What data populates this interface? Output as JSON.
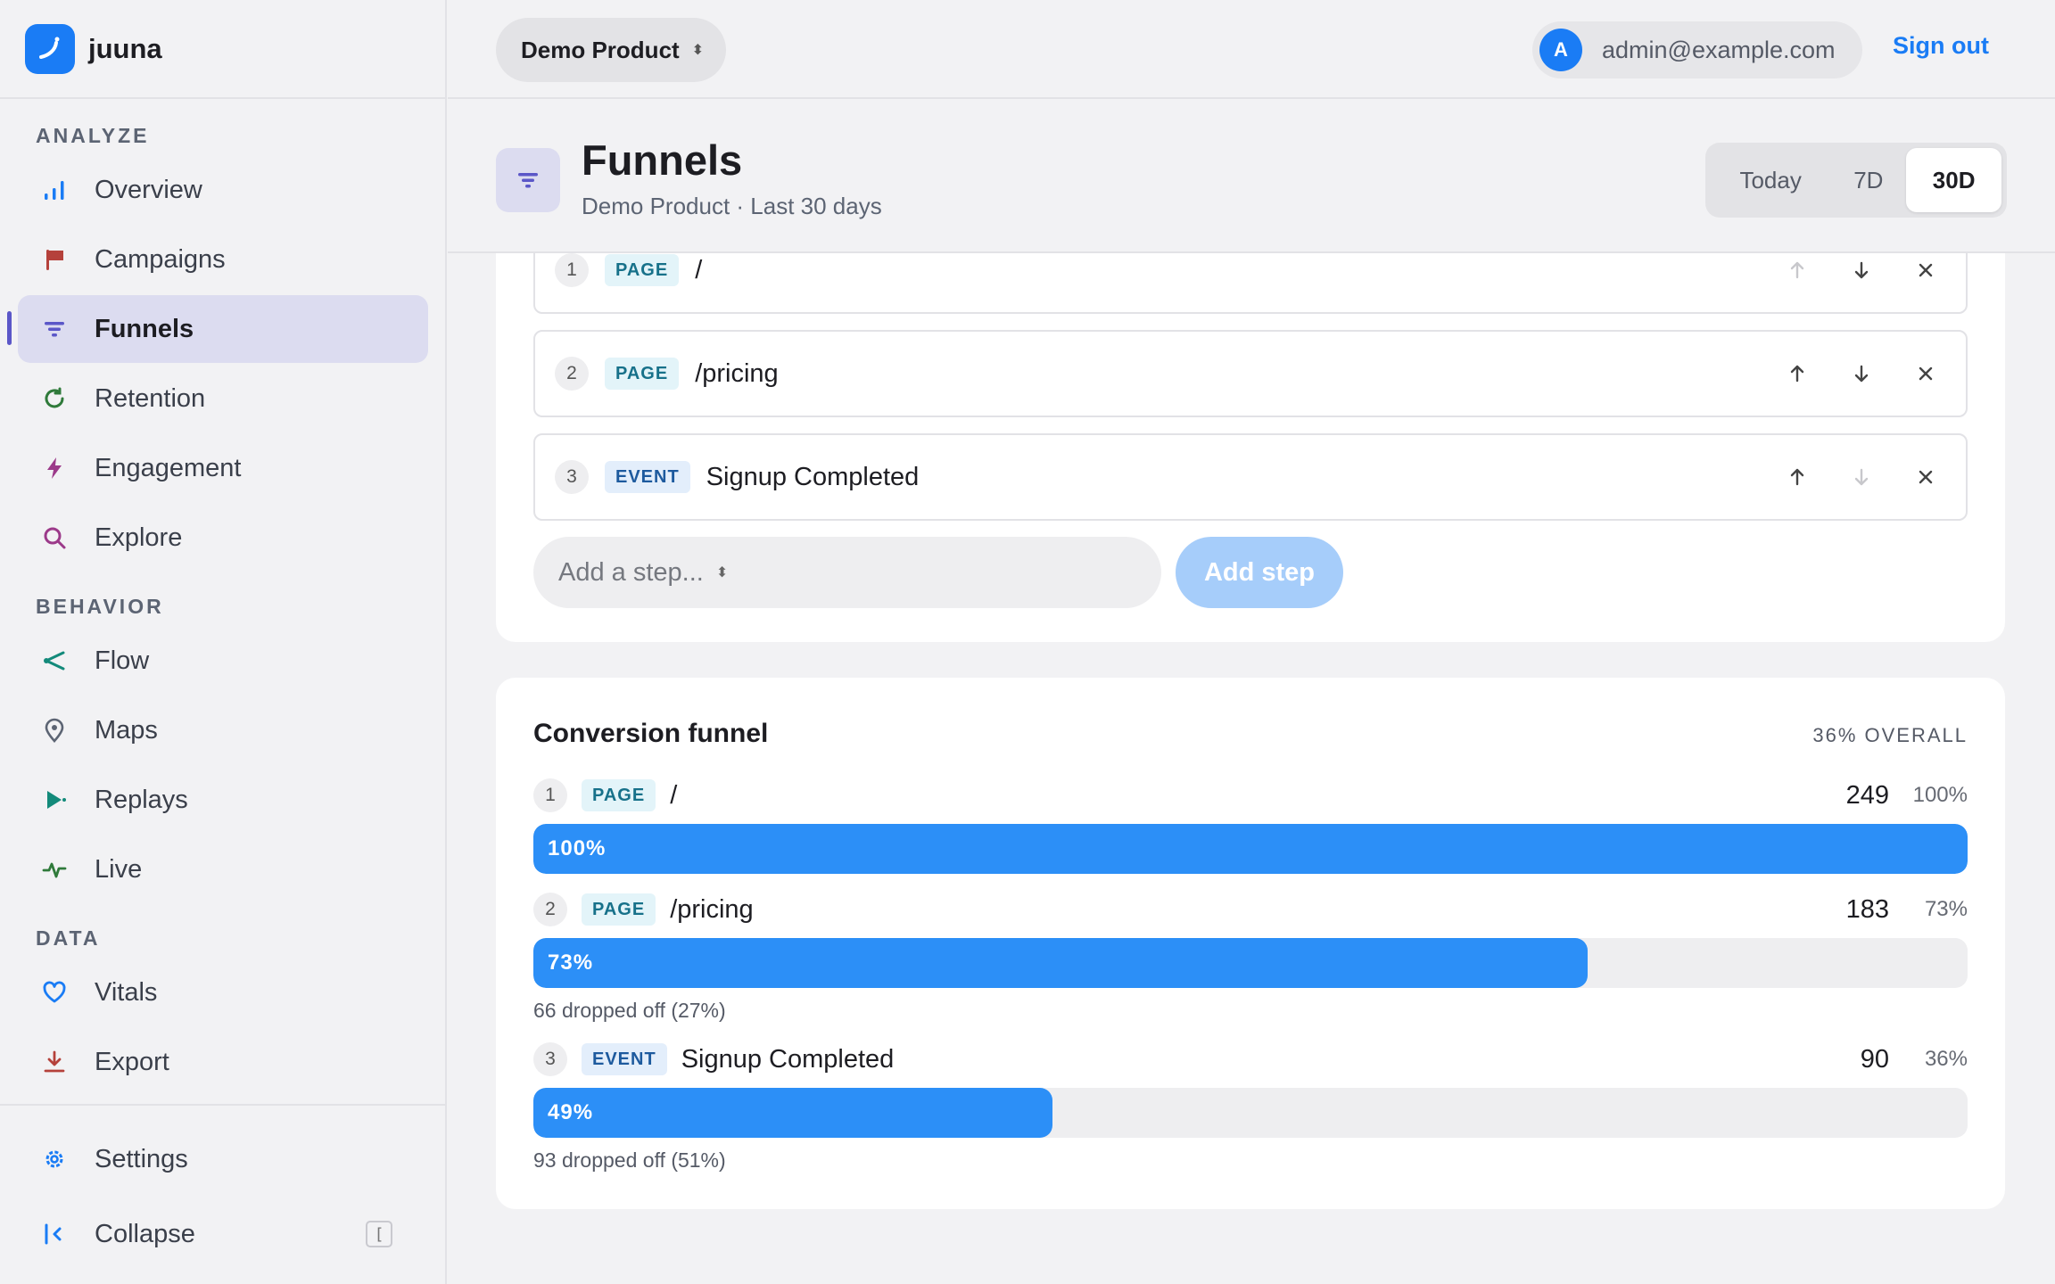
{
  "brand": {
    "name": "juuna"
  },
  "sidebar": {
    "sections": [
      {
        "label": "ANALYZE"
      },
      {
        "label": "BEHAVIOR"
      },
      {
        "label": "DATA"
      }
    ],
    "items": [
      {
        "label": "Overview",
        "icon": "bar-chart-icon",
        "color": "#1a7cf5"
      },
      {
        "label": "Campaigns",
        "icon": "flag-icon",
        "color": "#b5413b"
      },
      {
        "label": "Funnels",
        "icon": "funnel-icon",
        "color": "#5b57c8",
        "active": true
      },
      {
        "label": "Retention",
        "icon": "refresh-icon",
        "color": "#2f7a3a"
      },
      {
        "label": "Engagement",
        "icon": "bolt-icon",
        "color": "#9c3a8a"
      },
      {
        "label": "Explore",
        "icon": "search-icon",
        "color": "#9c3a8a"
      },
      {
        "label": "Flow",
        "icon": "share-icon",
        "color": "#138a7a"
      },
      {
        "label": "Maps",
        "icon": "map-pin-icon",
        "color": "#5c6473"
      },
      {
        "label": "Replays",
        "icon": "play-icon",
        "color": "#138a7a"
      },
      {
        "label": "Live",
        "icon": "pulse-icon",
        "color": "#2f7a3a"
      },
      {
        "label": "Vitals",
        "icon": "heart-icon",
        "color": "#1a7cf5"
      },
      {
        "label": "Export",
        "icon": "download-icon",
        "color": "#b5413b"
      }
    ],
    "settings_label": "Settings",
    "collapse_label": "Collapse",
    "collapse_shortcut": "["
  },
  "topbar": {
    "product": "Demo Product",
    "user_initial": "A",
    "user_email": "admin@example.com",
    "signout_label": "Sign out"
  },
  "header": {
    "title": "Funnels",
    "subtitle": "Demo Product · Last 30 days",
    "ranges": [
      "Today",
      "7D",
      "30D"
    ],
    "selected_range": "30D"
  },
  "steps_editor": {
    "steps": [
      {
        "num": "1",
        "type": "PAGE",
        "label": "/"
      },
      {
        "num": "2",
        "type": "PAGE",
        "label": "/pricing"
      },
      {
        "num": "3",
        "type": "EVENT",
        "label": "Signup Completed"
      }
    ],
    "add_placeholder": "Add a step...",
    "add_button": "Add step"
  },
  "funnel": {
    "title": "Conversion funnel",
    "overall": "36% OVERALL",
    "steps": [
      {
        "num": "1",
        "type": "PAGE",
        "label": "/",
        "count": "249",
        "pct_total": "100%",
        "bar_label": "100%",
        "fill": 1.0,
        "dropoff": ""
      },
      {
        "num": "2",
        "type": "PAGE",
        "label": "/pricing",
        "count": "183",
        "pct_total": "73%",
        "bar_label": "73%",
        "fill": 0.735,
        "dropoff": "66 dropped off (27%)"
      },
      {
        "num": "3",
        "type": "EVENT",
        "label": "Signup Completed",
        "count": "90",
        "pct_total": "36%",
        "bar_label": "49%",
        "fill": 0.362,
        "dropoff": "93 dropped off (51%)"
      }
    ]
  }
}
